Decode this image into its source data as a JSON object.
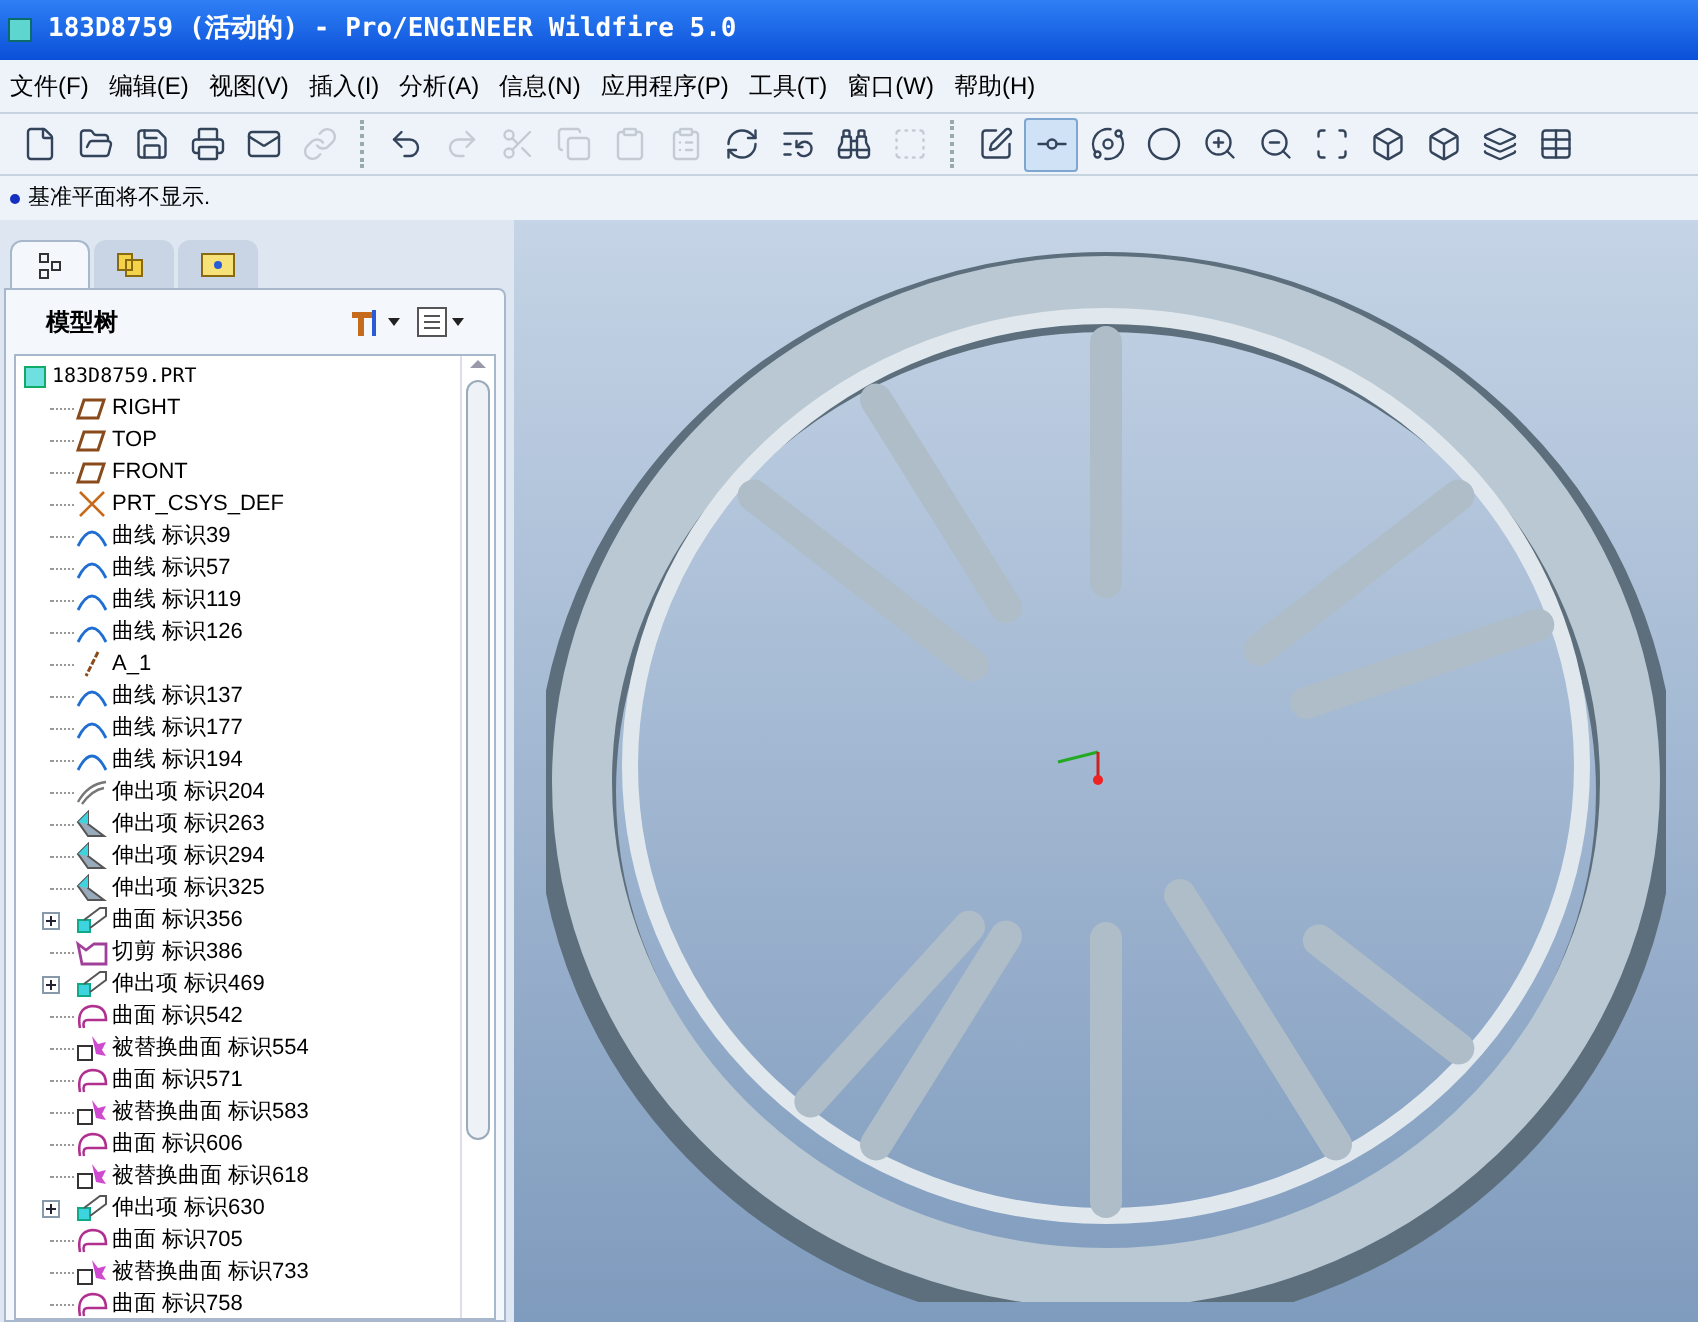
{
  "window": {
    "title": "183D8759 (活动的) - Pro/ENGINEER Wildfire 5.0"
  },
  "menu": [
    "文件(F)",
    "编辑(E)",
    "视图(V)",
    "插入(I)",
    "分析(A)",
    "信息(N)",
    "应用程序(P)",
    "工具(T)",
    "窗口(W)",
    "帮助(H)"
  ],
  "toolbar": [
    {
      "kind": "new",
      "disabled": false,
      "pressed": false
    },
    {
      "kind": "open",
      "disabled": false,
      "pressed": false
    },
    {
      "kind": "save",
      "disabled": false,
      "pressed": false
    },
    {
      "kind": "print",
      "disabled": false,
      "pressed": false
    },
    {
      "kind": "mail",
      "disabled": false,
      "pressed": false
    },
    {
      "kind": "link",
      "disabled": true,
      "pressed": false
    }
  ],
  "toolbar_2": [
    {
      "kind": "undo",
      "disabled": false,
      "pressed": false
    },
    {
      "kind": "redo",
      "disabled": true,
      "pressed": false
    },
    {
      "kind": "cut",
      "disabled": true,
      "pressed": false
    },
    {
      "kind": "copy",
      "disabled": true,
      "pressed": false
    },
    {
      "kind": "paste",
      "disabled": true,
      "pressed": false
    },
    {
      "kind": "pastespecial",
      "disabled": true,
      "pressed": false
    },
    {
      "kind": "regen",
      "disabled": false,
      "pressed": false
    },
    {
      "kind": "regenmanager",
      "disabled": false,
      "pressed": false
    },
    {
      "kind": "find",
      "disabled": false,
      "pressed": false
    },
    {
      "kind": "select",
      "disabled": true,
      "pressed": false
    }
  ],
  "toolbar_3": [
    {
      "kind": "datum",
      "disabled": false,
      "pressed": false
    },
    {
      "kind": "axis",
      "disabled": false,
      "pressed": true
    },
    {
      "kind": "spin",
      "disabled": false,
      "pressed": false
    },
    {
      "kind": "shade",
      "disabled": false,
      "pressed": false
    },
    {
      "kind": "zoomin",
      "disabled": false,
      "pressed": false
    },
    {
      "kind": "zoomout",
      "disabled": false,
      "pressed": false
    },
    {
      "kind": "refit",
      "disabled": false,
      "pressed": false
    },
    {
      "kind": "reorient",
      "disabled": false,
      "pressed": false
    },
    {
      "kind": "views",
      "disabled": false,
      "pressed": false
    },
    {
      "kind": "layers",
      "disabled": false,
      "pressed": false
    },
    {
      "kind": "table",
      "disabled": false,
      "pressed": false
    }
  ],
  "message": "基准平面将不显示.",
  "panel_tabs": [
    {
      "kind": "tree",
      "selected": true
    },
    {
      "kind": "folders",
      "selected": false
    },
    {
      "kind": "favorites",
      "selected": false
    }
  ],
  "model_tree": {
    "title": "模型树",
    "root": "183D8759.PRT",
    "items": [
      {
        "kind": "plane",
        "label": "RIGHT",
        "collapsed": false
      },
      {
        "kind": "plane",
        "label": "TOP",
        "collapsed": false
      },
      {
        "kind": "plane",
        "label": "FRONT",
        "collapsed": false
      },
      {
        "kind": "csys",
        "label": "PRT_CSYS_DEF",
        "collapsed": false
      },
      {
        "kind": "curve",
        "label": "曲线 标识39",
        "collapsed": false
      },
      {
        "kind": "curve",
        "label": "曲线 标识57",
        "collapsed": false
      },
      {
        "kind": "curve",
        "label": "曲线 标识119",
        "collapsed": false
      },
      {
        "kind": "curve",
        "label": "曲线 标识126",
        "collapsed": false
      },
      {
        "kind": "axis",
        "label": "A_1",
        "collapsed": false
      },
      {
        "kind": "curve",
        "label": "曲线 标识137",
        "collapsed": false
      },
      {
        "kind": "curve",
        "label": "曲线 标识177",
        "collapsed": false
      },
      {
        "kind": "curve",
        "label": "曲线 标识194",
        "collapsed": false
      },
      {
        "kind": "sweep",
        "label": "伸出项 标识204",
        "collapsed": false
      },
      {
        "kind": "blend",
        "label": "伸出项 标识263",
        "collapsed": false
      },
      {
        "kind": "blend",
        "label": "伸出项 标识294",
        "collapsed": false
      },
      {
        "kind": "blend",
        "label": "伸出项 标识325",
        "collapsed": false
      },
      {
        "kind": "group",
        "label": "曲面 标识356",
        "collapsed": true
      },
      {
        "kind": "cut",
        "label": "切剪 标识386",
        "collapsed": false
      },
      {
        "kind": "group",
        "label": "伸出项 标识469",
        "collapsed": true
      },
      {
        "kind": "surface",
        "label": "曲面 标识542",
        "collapsed": false
      },
      {
        "kind": "replace",
        "label": "被替换曲面 标识554",
        "collapsed": false
      },
      {
        "kind": "surface",
        "label": "曲面 标识571",
        "collapsed": false
      },
      {
        "kind": "replace",
        "label": "被替换曲面 标识583",
        "collapsed": false
      },
      {
        "kind": "surface",
        "label": "曲面 标识606",
        "collapsed": false
      },
      {
        "kind": "replace",
        "label": "被替换曲面 标识618",
        "collapsed": false
      },
      {
        "kind": "group",
        "label": "伸出项 标识630",
        "collapsed": true
      },
      {
        "kind": "surface",
        "label": "曲面 标识705",
        "collapsed": false
      },
      {
        "kind": "replace",
        "label": "被替换曲面 标识733",
        "collapsed": false
      },
      {
        "kind": "surface",
        "label": "曲面 标识758",
        "collapsed": false
      }
    ]
  }
}
